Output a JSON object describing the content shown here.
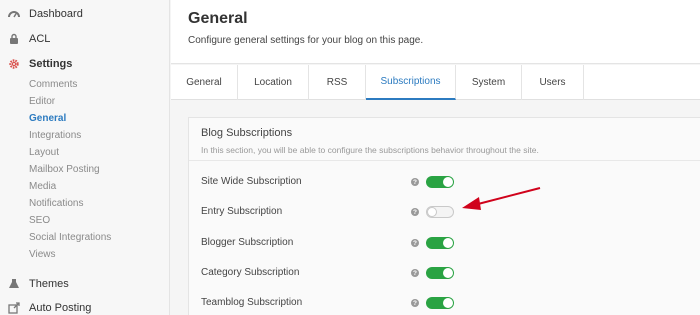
{
  "sidebar": {
    "items": [
      {
        "label": "Dashboard",
        "icon": "dashboard-icon"
      },
      {
        "label": "ACL",
        "icon": "lock-icon"
      },
      {
        "label": "Settings",
        "icon": "gear-icon"
      },
      {
        "label": "Themes",
        "icon": "themes-icon"
      },
      {
        "label": "Auto Posting",
        "icon": "share-icon"
      }
    ],
    "settings_subitems": [
      "Comments",
      "Editor",
      "General",
      "Integrations",
      "Layout",
      "Mailbox Posting",
      "Media",
      "Notifications",
      "SEO",
      "Social Integrations",
      "Views"
    ],
    "active_subitem": "General"
  },
  "header": {
    "title": "General",
    "description": "Configure general settings for your blog on this page."
  },
  "tabs": [
    "General",
    "Location",
    "RSS",
    "Subscriptions",
    "System",
    "Users"
  ],
  "active_tab": "Subscriptions",
  "panel": {
    "title": "Blog Subscriptions",
    "description": "In this section, you will be able to configure the subscriptions behavior throughout the site.",
    "rows": [
      {
        "label": "Site Wide Subscription",
        "enabled": true
      },
      {
        "label": "Entry Subscription",
        "enabled": false
      },
      {
        "label": "Blogger Subscription",
        "enabled": true
      },
      {
        "label": "Category Subscription",
        "enabled": true
      },
      {
        "label": "Teamblog Subscription",
        "enabled": true
      }
    ],
    "help_glyph": "?"
  },
  "colors": {
    "accent": "#2c7bc0",
    "toggle_on": "#2aa343",
    "gear": "#d9534f",
    "arrow": "#d0021b"
  }
}
